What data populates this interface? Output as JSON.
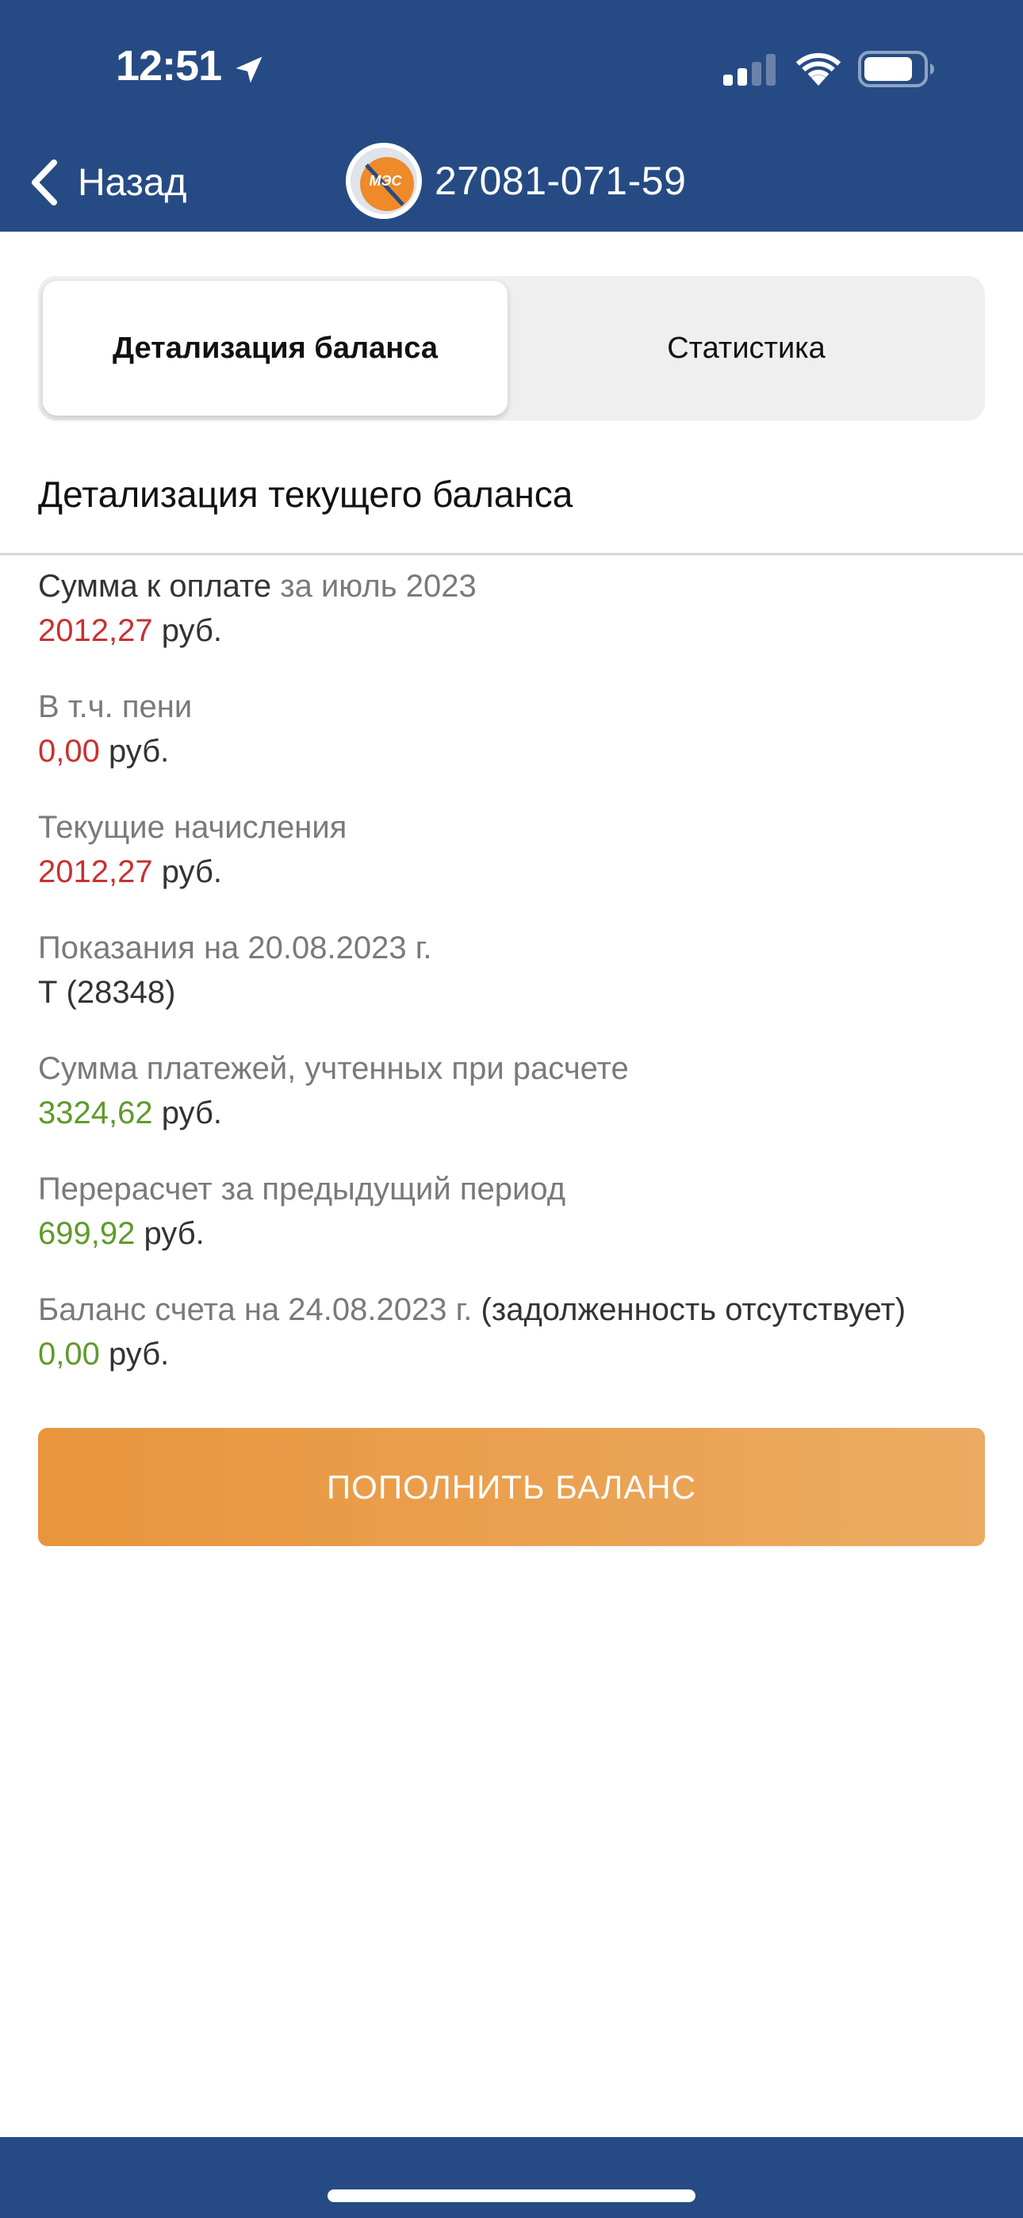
{
  "status_bar": {
    "time": "12:51"
  },
  "nav": {
    "back_label": "Назад",
    "account_number": "27081-071-59",
    "logo_text": "МЭС"
  },
  "tabs": [
    {
      "label": "Детализация баланса",
      "active": true
    },
    {
      "label": "Статистика",
      "active": false
    }
  ],
  "section_title": "Детализация текущего баланса",
  "details": [
    {
      "label": "Сумма к оплате",
      "label_suffix": "за июль 2023",
      "amount": "2012,27",
      "unit": "руб.",
      "amount_color": "#c93131"
    },
    {
      "label": "В т.ч. пени",
      "amount": "0,00",
      "unit": "руб.",
      "amount_color": "#c93131"
    },
    {
      "label": "Текущие начисления",
      "amount": "2012,27",
      "unit": "руб.",
      "amount_color": "#c93131"
    },
    {
      "label": "Показания на 20.08.2023 г.",
      "value": "Т (28348)"
    },
    {
      "label": "Сумма платежей, учтенных при расчете",
      "amount": "3324,62",
      "unit": "руб.",
      "amount_color": "#5f9a2a"
    },
    {
      "label": "Перерасчет за предыдущий период",
      "amount": "699,92",
      "unit": "руб.",
      "amount_color": "#5f9a2a"
    },
    {
      "label": "Баланс счета на 24.08.2023 г.",
      "label_note": "(задолженность отсутствует)",
      "amount": "0,00",
      "unit": "руб.",
      "amount_color": "#5f9a2a"
    }
  ],
  "topup_button_label": "ПОПОЛНИТЬ БАЛАНС",
  "colors": {
    "header_bg": "#264b84",
    "accent_orange": "#e8953c",
    "amount_red": "#c93131",
    "amount_green": "#5f9a2a"
  }
}
